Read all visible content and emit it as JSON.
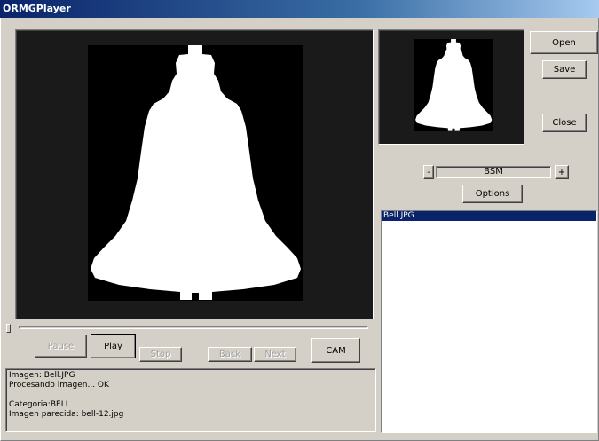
{
  "window": {
    "title": "ORMGPlayer"
  },
  "colors": {
    "titlebar": "#0a246a",
    "selection": "#0a246a",
    "face": "#d4d0c8"
  },
  "buttons": {
    "open": "Open",
    "save": "Save",
    "close": "Close",
    "options": "Options",
    "minus": "-",
    "plus": "+",
    "pause": "Pause",
    "play": "Play",
    "stop": "Stop",
    "back": "Back",
    "next": "Next",
    "cam": "CAM"
  },
  "combo": {
    "value": "BSM"
  },
  "log": {
    "lines": [
      "Imagen: Bell.JPG",
      "Procesando imagen... OK",
      "",
      "Categoria:BELL",
      "Imagen parecida: bell-12.jpg"
    ]
  },
  "file_list": {
    "items": [
      {
        "label": "Bell.JPG",
        "selected": true
      }
    ]
  },
  "slider": {
    "position": 0
  }
}
